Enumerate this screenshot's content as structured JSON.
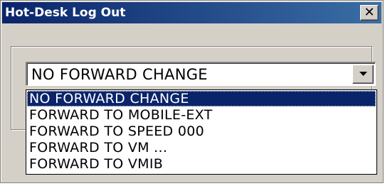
{
  "window": {
    "title": "Hot-Desk Log Out",
    "close_glyph": "✕"
  },
  "combo": {
    "selected_value": "NO FORWARD CHANGE",
    "arrow_icon": "chevron-down-icon"
  },
  "dropdown": {
    "options": [
      "NO FORWARD CHANGE",
      "FORWARD TO MOBILE-EXT",
      "FORWARD TO SPEED 000",
      "FORWARD TO VM ...",
      "FORWARD TO VMIB"
    ],
    "selected_index": 0
  },
  "colors": {
    "title_bar": "#0a246a",
    "selection": "#0a246a",
    "face": "#d4d0c8"
  }
}
